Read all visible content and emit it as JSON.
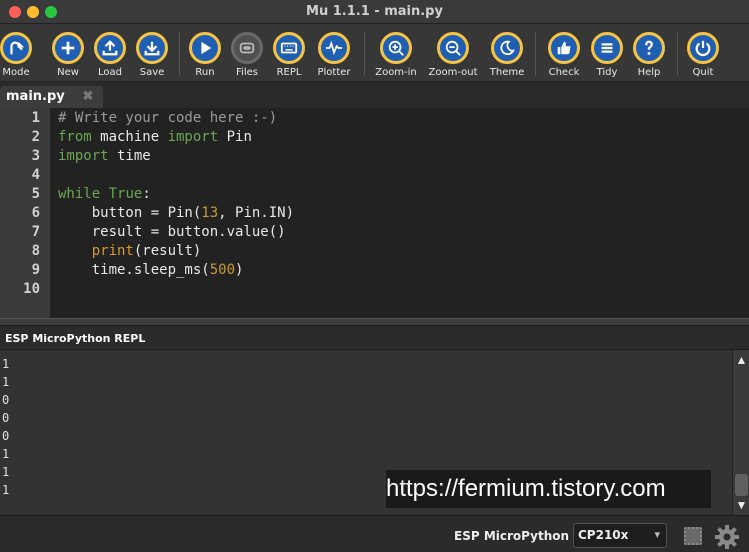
{
  "window": {
    "title": "Mu 1.1.1 - main.py"
  },
  "toolbar": {
    "buttons": [
      {
        "id": "mode",
        "label": "Mode",
        "icon": "mode-icon"
      },
      {
        "id": "new",
        "label": "New",
        "icon": "plus-icon"
      },
      {
        "id": "load",
        "label": "Load",
        "icon": "upload-icon"
      },
      {
        "id": "save",
        "label": "Save",
        "icon": "download-icon"
      },
      {
        "id": "run",
        "label": "Run",
        "icon": "play-icon"
      },
      {
        "id": "files",
        "label": "Files",
        "icon": "files-icon"
      },
      {
        "id": "repl",
        "label": "REPL",
        "icon": "keyboard-icon"
      },
      {
        "id": "plotter",
        "label": "Plotter",
        "icon": "pulse-icon"
      },
      {
        "id": "zoom_in",
        "label": "Zoom-in",
        "icon": "zoom-in-icon"
      },
      {
        "id": "zoom_out",
        "label": "Zoom-out",
        "icon": "zoom-out-icon"
      },
      {
        "id": "theme",
        "label": "Theme",
        "icon": "moon-icon"
      },
      {
        "id": "check",
        "label": "Check",
        "icon": "thumbs-up-icon"
      },
      {
        "id": "tidy",
        "label": "Tidy",
        "icon": "list-icon"
      },
      {
        "id": "help",
        "label": "Help",
        "icon": "question-icon"
      },
      {
        "id": "quit",
        "label": "Quit",
        "icon": "power-icon"
      }
    ]
  },
  "tabs": [
    {
      "label": "main.py",
      "close": "✖"
    }
  ],
  "editor": {
    "line_numbers": [
      "1",
      "2",
      "3",
      "4",
      "5",
      "6",
      "7",
      "8",
      "9",
      "10"
    ],
    "lines": [
      "# Write your code here :-)",
      "from machine import Pin",
      "import time",
      "",
      "while True:",
      "    button = Pin(13, Pin.IN)",
      "    result = button.value()",
      "    print(result)",
      "    time.sleep_ms(500)",
      ""
    ]
  },
  "repl": {
    "title": "ESP MicroPython REPL",
    "output": [
      "1",
      "1",
      "0",
      "0",
      "0",
      "1",
      "1",
      "1"
    ]
  },
  "watermark": "https://fermium.tistory.com",
  "statusbar": {
    "mode": "ESP MicroPython",
    "port": "CP210x"
  },
  "colors": {
    "button_fill": "#1f5fb3",
    "button_ring": "#f6c342",
    "keyword": "#6aa84f",
    "builtin": "#d49a2a"
  }
}
